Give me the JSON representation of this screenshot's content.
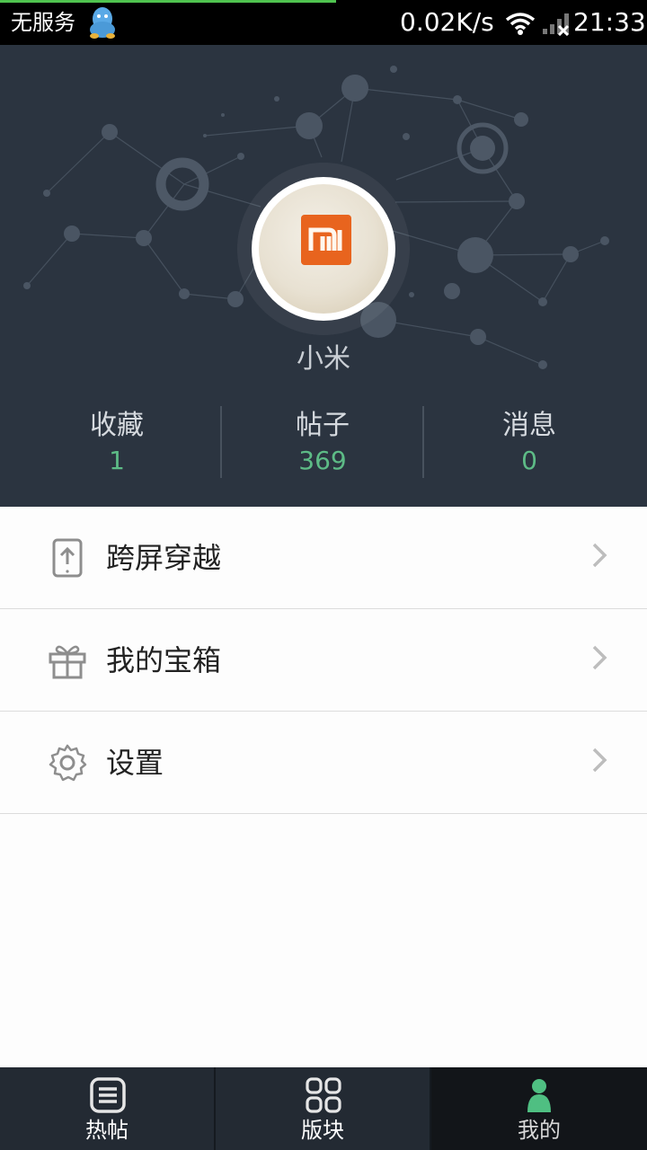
{
  "status_bar": {
    "carrier": "无服务",
    "net_speed": "0.02K/s",
    "time": "21:33",
    "progress_fraction": 0.52,
    "icons": [
      "qq-icon",
      "wifi-icon",
      "signal-icon"
    ]
  },
  "profile": {
    "username": "小米",
    "stats": [
      {
        "label": "收藏",
        "value": "1"
      },
      {
        "label": "帖子",
        "value": "369"
      },
      {
        "label": "消息",
        "value": "0"
      }
    ]
  },
  "menu": [
    {
      "label": "跨屏穿越",
      "icon": "cross-screen-icon"
    },
    {
      "label": "我的宝箱",
      "icon": "gift-icon"
    },
    {
      "label": "设置",
      "icon": "gear-icon"
    }
  ],
  "bottom_nav": {
    "tabs": [
      {
        "label": "热帖",
        "icon": "list-icon",
        "active": false
      },
      {
        "label": "版块",
        "icon": "grid-icon",
        "active": false
      },
      {
        "label": "我的",
        "icon": "person-icon",
        "active": true
      }
    ]
  },
  "colors": {
    "header_bg": "#2b3440",
    "stat_value": "#5dbb86",
    "accent_green": "#4fc34f",
    "nav_bg": "#232a33",
    "nav_active_bg": "#121519"
  }
}
